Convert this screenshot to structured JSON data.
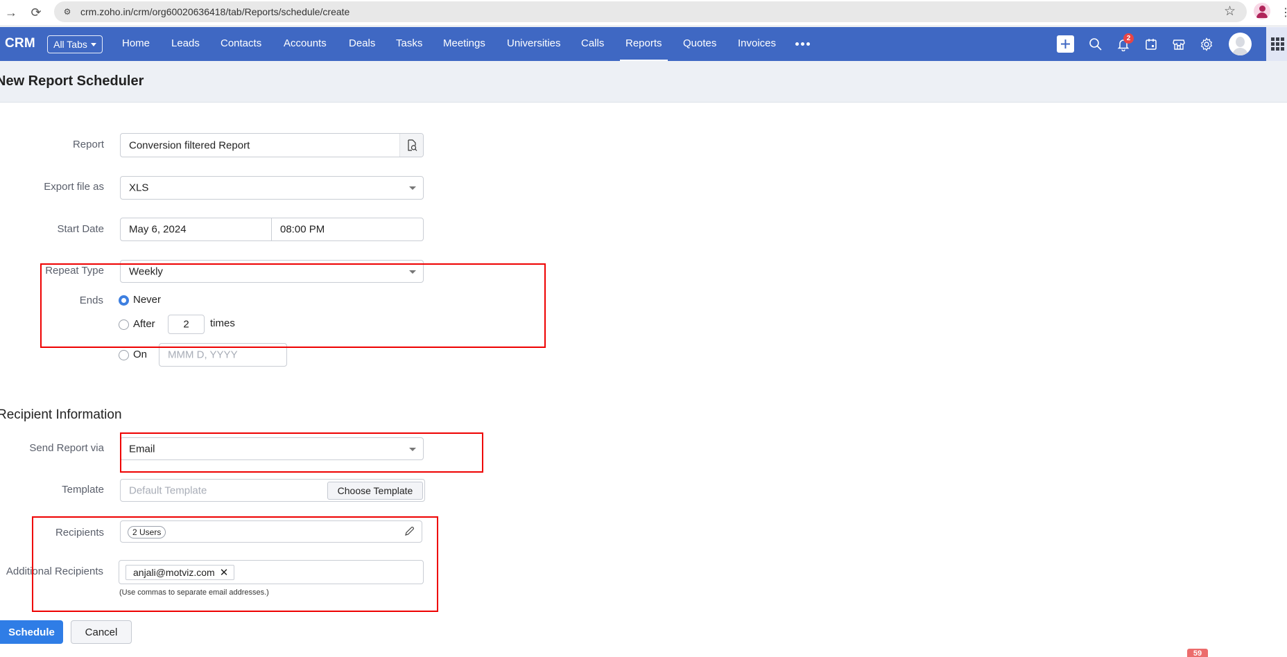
{
  "browser": {
    "url": "crm.zoho.in/crm/org60020636418/tab/Reports/schedule/create"
  },
  "nav": {
    "logo": "CRM",
    "all_tabs": "All Tabs",
    "tabs": [
      {
        "label": "Home"
      },
      {
        "label": "Leads"
      },
      {
        "label": "Contacts"
      },
      {
        "label": "Accounts"
      },
      {
        "label": "Deals"
      },
      {
        "label": "Tasks"
      },
      {
        "label": "Meetings"
      },
      {
        "label": "Universities"
      },
      {
        "label": "Calls"
      },
      {
        "label": "Reports",
        "active": true
      },
      {
        "label": "Quotes"
      },
      {
        "label": "Invoices"
      }
    ],
    "notification_count": "2",
    "accent_color": "#3f68c3"
  },
  "page": {
    "title": "New Report Scheduler"
  },
  "form": {
    "report": {
      "label": "Report",
      "value": "Conversion filtered Report"
    },
    "export": {
      "label": "Export file as",
      "value": "XLS"
    },
    "start_date": {
      "label": "Start Date",
      "date": "May 6, 2024",
      "time": "08:00 PM"
    },
    "repeat": {
      "label": "Repeat Type",
      "value": "Weekly"
    },
    "ends": {
      "label": "Ends",
      "never": "Never",
      "after": "After",
      "after_count": "2",
      "times": "times",
      "on": "On",
      "on_placeholder": "MMM D, YYYY",
      "selected": "never"
    }
  },
  "recipients_section": {
    "title": "Recipient Information",
    "send_via": {
      "label": "Send Report via",
      "value": "Email"
    },
    "template": {
      "label": "Template",
      "placeholder": "Default Template",
      "button": "Choose Template"
    },
    "recipients": {
      "label": "Recipients",
      "chip": "2 Users"
    },
    "additional": {
      "label": "Additional Recipients",
      "emails": [
        "anjali@motviz.com"
      ],
      "hint": "(Use commas to separate email addresses.)"
    }
  },
  "actions": {
    "schedule": "Schedule",
    "cancel": "Cancel"
  },
  "floating_badge": "59",
  "annotation_color": "#ee0000"
}
